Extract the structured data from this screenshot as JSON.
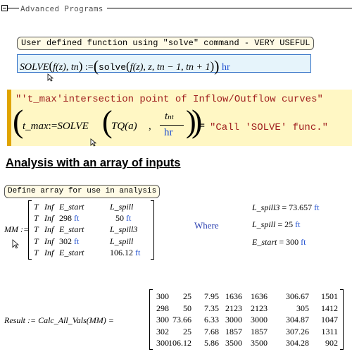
{
  "region": {
    "title": "Advanced Programs"
  },
  "solve_note": "User defined function using \"solve\" command - VERY USEFUL",
  "solve_def": {
    "lhs_name": "SOLVE",
    "lhs_args": "f(z), tn",
    "assign": ":=",
    "fn": "solve",
    "args": "f(z), z, tn − 1, tn + 1",
    "unit": "hr"
  },
  "tmax": {
    "comment": "\"'t_max'intersection point of Inflow/Outflow curves\"",
    "lhs": "t_max",
    "assign": ":=",
    "call": "SOLVE",
    "arg1": "TQ(a)",
    "frac_num": "t",
    "frac_num_sub": "nt",
    "frac_den": "hr",
    "eq": "=",
    "result": "\"Call 'SOLVE' func.\""
  },
  "analysis": {
    "heading": "Analysis with an array of inputs",
    "note": "Define array for use in analysis",
    "mm_label": "MM :=",
    "mm_rows": [
      {
        "c1": "T",
        "c2": "Inf",
        "c3": "E_start",
        "c4": "L_spill"
      },
      {
        "c1": "T",
        "c2": "Inf",
        "c3": "298",
        "u3": "ft",
        "c4": "50",
        "u4": "ft"
      },
      {
        "c1": "T",
        "c2": "Inf",
        "c3": "E_start",
        "c4": "L_spill3"
      },
      {
        "c1": "T",
        "c2": "Inf",
        "c3": "302",
        "u3": "ft",
        "c4": "L_spill"
      },
      {
        "c1": "T",
        "c2": "Inf",
        "c3": "E_start",
        "c4": "106.12",
        "u4": "ft"
      }
    ],
    "where": "Where",
    "defs": [
      {
        "name": "L_spill3",
        "eq": "=",
        "value": "73.657",
        "unit": "ft"
      },
      {
        "name": "L_spill",
        "eq": "=",
        "value": "25",
        "unit": "ft"
      },
      {
        "name": "E_start",
        "eq": "=",
        "value": "300",
        "unit": "ft"
      }
    ],
    "result_label": "Result := Calc_All_Vals(MM) =",
    "result_rows": [
      [
        "300",
        "25",
        "7.95",
        "1636",
        "1636",
        "306.67",
        "1501"
      ],
      [
        "298",
        "50",
        "7.35",
        "2123",
        "2123",
        "305",
        "1412"
      ],
      [
        "300",
        "73.66",
        "6.33",
        "3000",
        "3000",
        "304.87",
        "1047"
      ],
      [
        "302",
        "25",
        "7.68",
        "1857",
        "1857",
        "307.26",
        "1311"
      ],
      [
        "300",
        "106.12",
        "5.86",
        "3500",
        "3500",
        "304.28",
        "902"
      ]
    ]
  },
  "colors": {
    "unit_blue": "#1f4fd0",
    "note_bg": "#fffbe6",
    "solve_bg": "#e6f4fb",
    "tmax_bg": "#fff7c4",
    "tmax_accent": "#e0a400"
  }
}
